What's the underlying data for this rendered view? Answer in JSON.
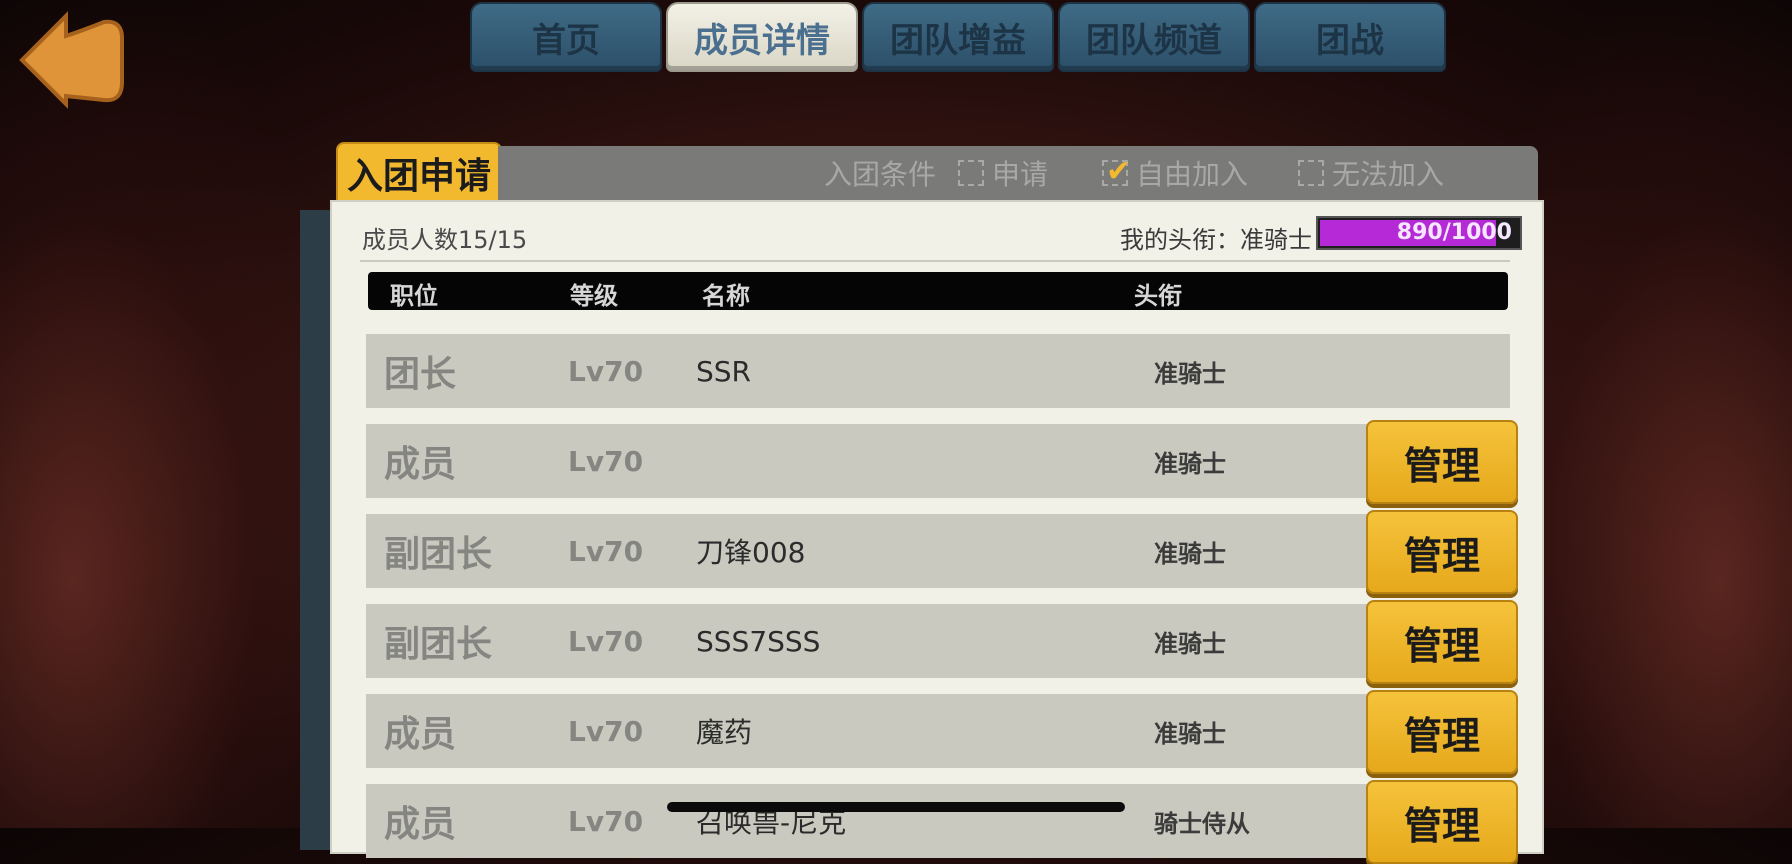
{
  "tabs": [
    {
      "label": "首页",
      "active": false
    },
    {
      "label": "成员详情",
      "active": true
    },
    {
      "label": "团队增益",
      "active": false
    },
    {
      "label": "团队频道",
      "active": false
    },
    {
      "label": "团战",
      "active": false
    }
  ],
  "panel": {
    "tab_label": "入团申请",
    "conditions_label": "入团条件",
    "options": [
      {
        "label": "申请",
        "checked": false
      },
      {
        "label": "自由加入",
        "checked": true
      },
      {
        "label": "无法加入",
        "checked": false
      }
    ],
    "member_count": "成员人数15/15",
    "my_title_label": "我的头衔：准骑士",
    "xp_text": "890/1000",
    "xp_fraction": 0.89
  },
  "columns": {
    "position": "职位",
    "level": "等级",
    "name": "名称",
    "title": "头衔"
  },
  "members": [
    {
      "position": "团长",
      "level": "Lv70",
      "name": "SSR",
      "title": "准骑士",
      "manage": ""
    },
    {
      "position": "成员",
      "level": "Lv70",
      "name": "",
      "title": "准骑士",
      "manage": "管理"
    },
    {
      "position": "副团长",
      "level": "Lv70",
      "name": "刀锋008",
      "title": "准骑士",
      "manage": "管理"
    },
    {
      "position": "副团长",
      "level": "Lv70",
      "name": "SSS7SSS",
      "title": "准骑士",
      "manage": "管理"
    },
    {
      "position": "成员",
      "level": "Lv70",
      "name": "魔药",
      "title": "准骑士",
      "manage": "管理"
    },
    {
      "position": "成员",
      "level": "Lv70",
      "name": "召唤兽-尼克",
      "title": "骑士侍从",
      "manage": "管理"
    }
  ],
  "colors": {
    "accent": "#f2b92f",
    "tab": "#3f6b86",
    "xp": "#b529d6"
  }
}
